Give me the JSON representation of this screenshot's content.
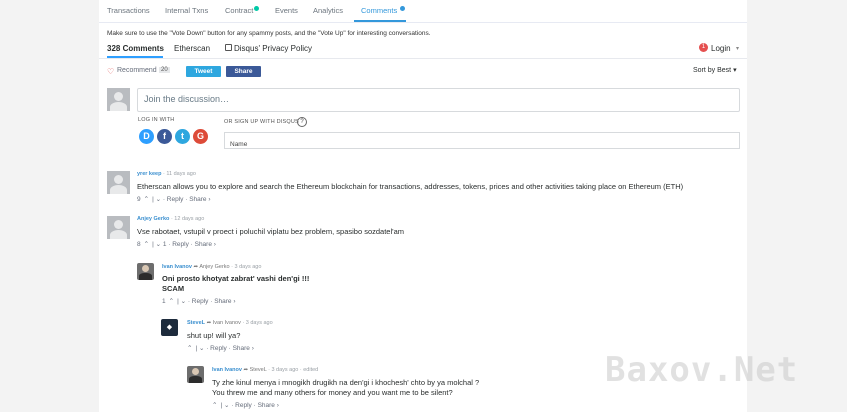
{
  "tabs": {
    "transactions": "Transactions",
    "internal_txns": "Internal Txns",
    "contract": "Contract",
    "events": "Events",
    "analytics": "Analytics",
    "comments": "Comments"
  },
  "notice": "Make sure to use the \"Vote Down\" button for any spammy posts, and the \"Vote Up\" for interesting conversations.",
  "header": {
    "comments_count": "328 Comments",
    "etherscan": "Etherscan",
    "privacy": "Disqus' Privacy Policy",
    "login_badge": "1",
    "login": "Login",
    "chevron": "▾"
  },
  "toolbar": {
    "heart": "♡",
    "recommend": "Recommend",
    "recommend_count": "20",
    "tweet": "Tweet",
    "share": "Share",
    "sort": "Sort by Best",
    "sort_chevron": "▾"
  },
  "composer": {
    "placeholder": "Join the discussion…",
    "login_with": "LOG IN WITH",
    "or_sign_up": "OR SIGN UP WITH DISQUS",
    "help": "?",
    "name_placeholder": "Name",
    "social": {
      "disqus": "D",
      "facebook": "f",
      "twitter": "t",
      "google": "G"
    }
  },
  "comments": [
    {
      "author": "yrer keep",
      "time": "· 11 days ago",
      "text": "Etherscan allows you to explore and search the Ethereum blockchain for transactions, addresses, tokens, prices and other activities taking place on Ethereum (ETH)",
      "votes": "9",
      "actions": "| ⌄ · Reply · Share ›"
    },
    {
      "author": "Anjey Gerko",
      "time": "· 12 days ago",
      "text": "Vse rabotaet, vstupil v proect i poluchil viplatu bez problem, spasibo sozdatel'am",
      "votes": "8",
      "actions": "| ⌄ 1 · Reply · Share ›"
    },
    {
      "author": "Ivan Ivanov",
      "reply_to": "➦ Anjey Gerko",
      "time": "· 3 days ago",
      "text": "Oni prosto khotyat zabrat' vashi den'gi !!!",
      "text2": "SCAM",
      "votes": "1",
      "actions": "| ⌄ · Reply · Share ›"
    },
    {
      "author": "SteveL",
      "reply_to": "➦ Ivan Ivanov",
      "time": "· 3 days ago",
      "text": "shut up! will ya?",
      "actions": "| ⌄ · Reply · Share ›"
    },
    {
      "author": "Ivan Ivanov",
      "reply_to": "➦ SteveL",
      "time": "· 3 days ago · edited",
      "text": "Ty zhe kinul menya i mnogikh drugikh na den'gi i khochesh' chto by ya molchal ?",
      "text2": "You threw me and many others for money and you want me to be silent?",
      "actions": "| ⌄ · Reply · Share ›"
    }
  ],
  "vote_up": "⌃",
  "watermark": "Baxov.Net",
  "colors": {
    "accent": "#3498db",
    "author": "#3a8fcf",
    "twitter": "#2ea7df",
    "facebook": "#3b5998",
    "google": "#dd4b39",
    "disqus": "#2e9fff",
    "badge": "#e55050"
  }
}
